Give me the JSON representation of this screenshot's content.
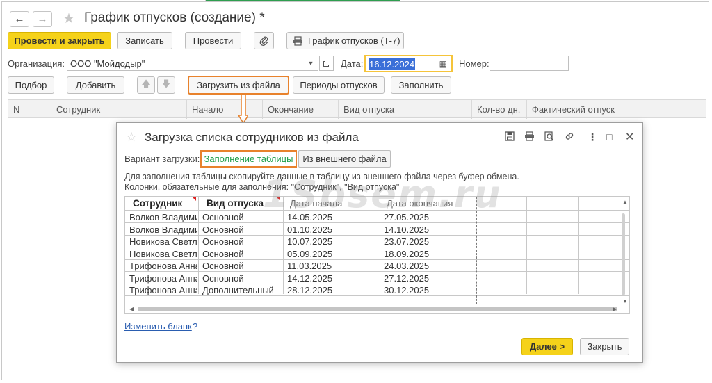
{
  "window": {
    "title": "График отпусков (создание) *"
  },
  "toolbar": {
    "post_close": "Провести и закрыть",
    "save": "Записать",
    "post": "Провести",
    "print_t7": "График отпусков (Т-7)"
  },
  "form": {
    "org_label": "Организация:",
    "org_value": "ООО \"Мойдодыр\"",
    "date_label": "Дата:",
    "date_value": "16.12.2024",
    "number_label": "Номер:",
    "number_value": ""
  },
  "table_toolbar": {
    "pick": "Подбор",
    "add": "Добавить",
    "load_file": "Загрузить из файла",
    "periods": "Периоды отпусков",
    "fill": "Заполнить"
  },
  "grid": {
    "columns": [
      "N",
      "Сотрудник",
      "Начало",
      "Окончание",
      "Вид отпуска",
      "Кол-во дн.",
      "Фактический отпуск"
    ]
  },
  "dialog": {
    "title": "Загрузка списка сотрудников из файла",
    "variant_label": "Вариант загрузки:",
    "variant_active": "Заполнение таблицы",
    "variant_other": "Из внешнего файла",
    "help_line1": "Для заполнения таблицы скопируйте данные в таблицу из внешнего файла через буфер обмена.",
    "help_line2": "Колонки, обязательные для заполнения: \"Сотрудник\", \"Вид отпуска\"",
    "sheet_headers": [
      "Сотрудник",
      "Вид отпуска",
      "Дата начала",
      "Дата окончания"
    ],
    "rows": [
      [
        "Волков Владимир",
        "Основной",
        "14.05.2025",
        "27.05.2025"
      ],
      [
        "Волков Владимир",
        "Основной",
        "01.10.2025",
        "14.10.2025"
      ],
      [
        "Новикова Светла",
        "Основной",
        "10.07.2025",
        "23.07.2025"
      ],
      [
        "Новикова Светла",
        "Основной",
        "05.09.2025",
        "18.09.2025"
      ],
      [
        "Трифонова Анна М",
        "Основной",
        "11.03.2025",
        "24.03.2025"
      ],
      [
        "Трифонова Анна М",
        "Основной",
        "14.12.2025",
        "27.12.2025"
      ],
      [
        "Трифонова Анна М",
        "Дополнительный",
        "28.12.2025",
        "30.12.2025"
      ]
    ],
    "change_form_link": "Изменить бланк",
    "help_q": "?",
    "next": "Далее >",
    "close": "Закрыть"
  },
  "watermark": "1Sbsem.ru",
  "colors": {
    "primary_button": "#f5d21a",
    "highlight_orange": "#e8822c",
    "active_green": "#1e9e4a",
    "date_focus": "#f5c43a",
    "link": "#2a5db0"
  }
}
